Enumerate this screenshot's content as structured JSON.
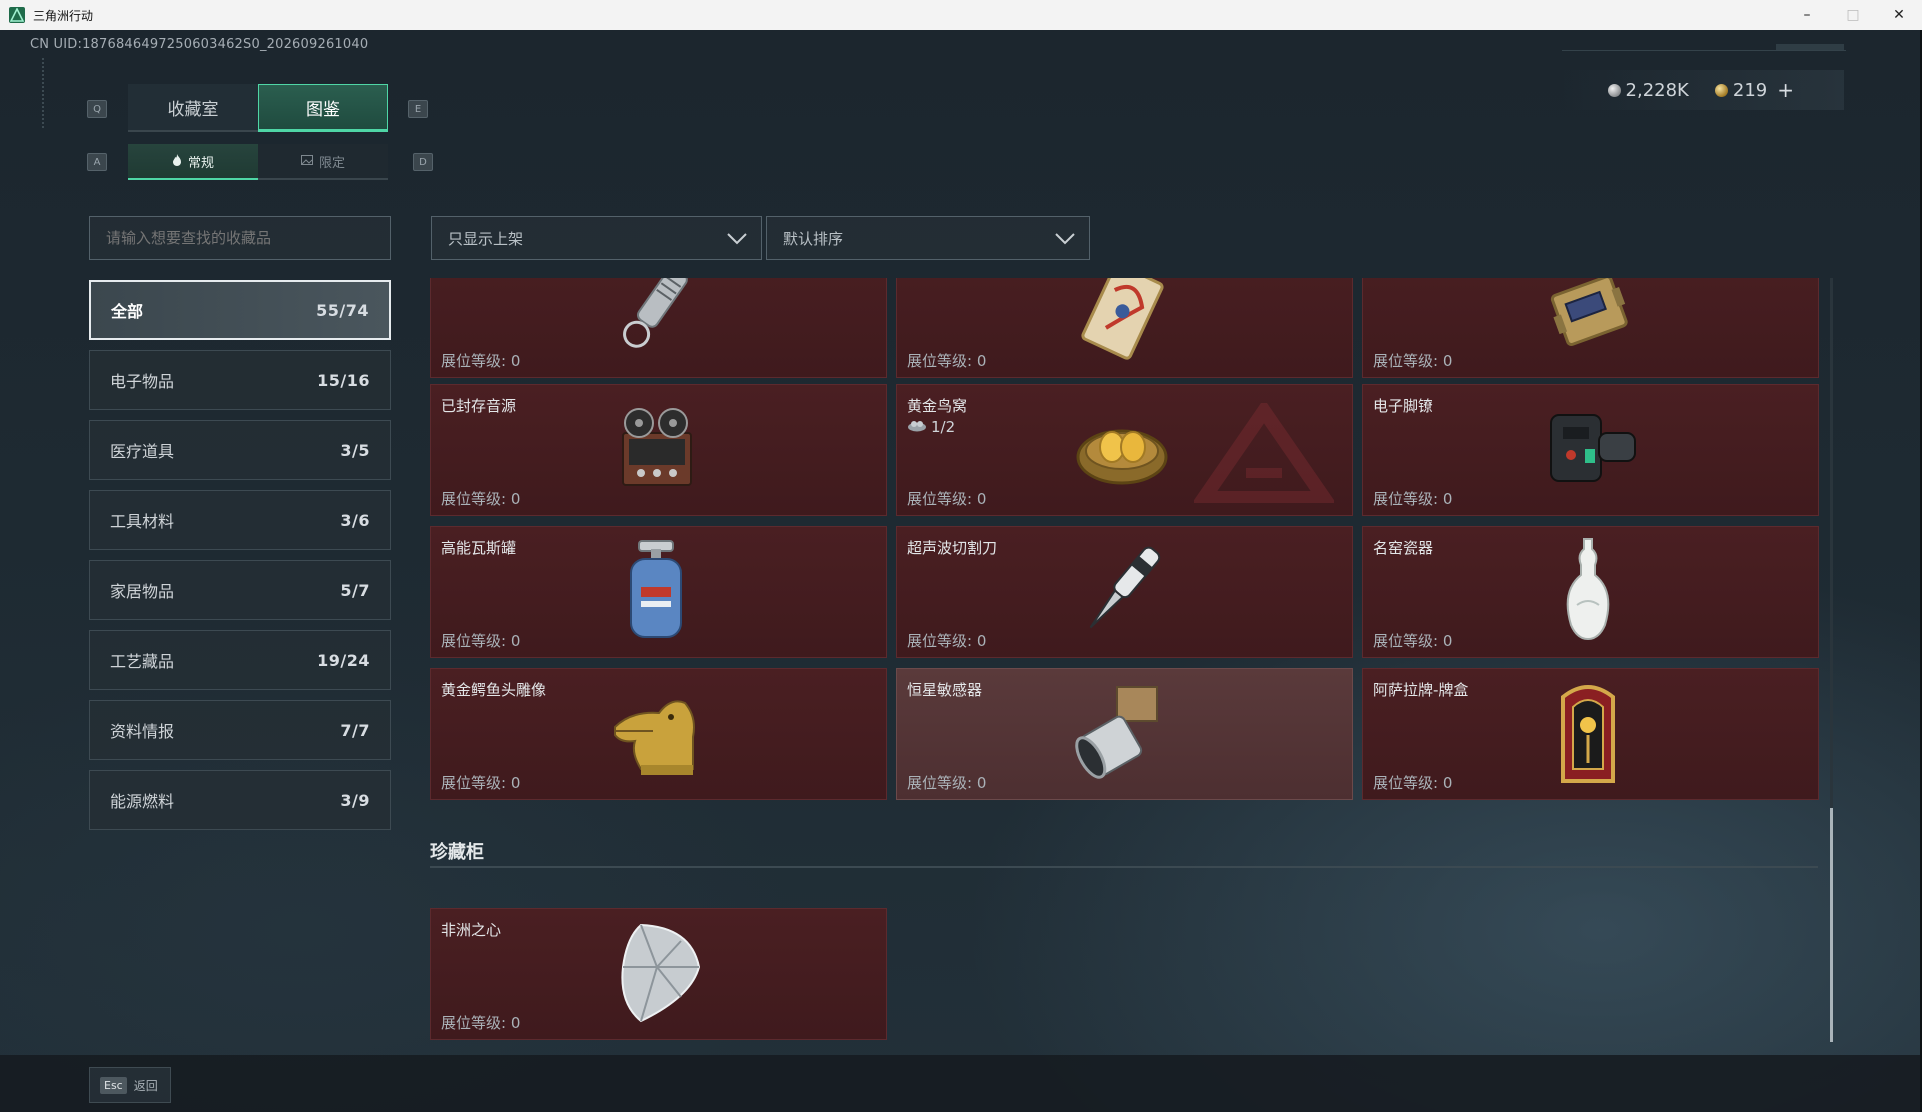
{
  "window": {
    "title": "三角洲行动",
    "controls": {
      "minimize": "–",
      "maximize": "□",
      "close": "✕"
    }
  },
  "header": {
    "uid": "CN UID:1876846497250603462S0_202609261040",
    "currency": {
      "silver_value": "2,228K",
      "gold_value": "219",
      "plus_label": "+"
    }
  },
  "keyhints": {
    "tab_prev": "Q",
    "tab_next": "E",
    "sub_prev": "A",
    "sub_next": "D"
  },
  "tabs": [
    {
      "label": "收藏室",
      "active": false
    },
    {
      "label": "图鉴",
      "active": true
    }
  ],
  "subtabs": [
    {
      "label": "常规",
      "icon": "flame-icon",
      "active": true
    },
    {
      "label": "限定",
      "icon": "image-icon",
      "active": false
    }
  ],
  "search": {
    "placeholder": "请输入想要查找的收藏品",
    "value": ""
  },
  "filters": {
    "shelf": {
      "selected": "只显示上架"
    },
    "sort": {
      "selected": "默认排序"
    }
  },
  "categories": [
    {
      "label": "全部",
      "count": "55/74",
      "active": true
    },
    {
      "label": "电子物品",
      "count": "15/16"
    },
    {
      "label": "医疗道具",
      "count": "3/5"
    },
    {
      "label": "工具材料",
      "count": "3/6"
    },
    {
      "label": "家居物品",
      "count": "5/7"
    },
    {
      "label": "工艺藏品",
      "count": "19/24"
    },
    {
      "label": "资料情报",
      "count": "7/7"
    },
    {
      "label": "能源燃料",
      "count": "3/9"
    }
  ],
  "items": [
    {
      "name": "",
      "level_label": "展位等级: 0",
      "icon": "flashlight-keychain-icon"
    },
    {
      "name": "",
      "level_label": "展位等级: 0",
      "icon": "ornate-card-icon"
    },
    {
      "name": "",
      "level_label": "展位等级: 0",
      "icon": "gold-device-icon"
    },
    {
      "name": "已封存音源",
      "level_label": "展位等级: 0",
      "icon": "reel-recorder-icon"
    },
    {
      "name": "黄金鸟窝",
      "sub": "1/2",
      "level_label": "展位等级: 0",
      "icon": "golden-nest-icon"
    },
    {
      "name": "电子脚镣",
      "level_label": "展位等级: 0",
      "icon": "ankle-monitor-icon"
    },
    {
      "name": "高能瓦斯罐",
      "level_label": "展位等级: 0",
      "icon": "gas-canister-icon"
    },
    {
      "name": "超声波切割刀",
      "level_label": "展位等级: 0",
      "icon": "ultrasonic-cutter-icon"
    },
    {
      "name": "名窑瓷器",
      "level_label": "展位等级: 0",
      "icon": "porcelain-vase-icon"
    },
    {
      "name": "黄金鳄鱼头雕像",
      "level_label": "展位等级: 0",
      "icon": "golden-crocodile-icon"
    },
    {
      "name": "恒星敏感器",
      "level_label": "展位等级: 0",
      "icon": "star-sensor-icon"
    },
    {
      "name": "阿萨拉牌-牌盒",
      "level_label": "展位等级: 0",
      "icon": "card-box-icon"
    }
  ],
  "section": {
    "title": "珍藏柜",
    "items": [
      {
        "name": "非洲之心",
        "level_label": "展位等级: 0",
        "icon": "diamond-icon"
      }
    ]
  },
  "footer": {
    "esc_key": "Esc",
    "back_label": "返回"
  },
  "colors": {
    "accent": "#4fd6a6",
    "card_bg": "#4a1f22",
    "panel_bg": "#242e35"
  }
}
